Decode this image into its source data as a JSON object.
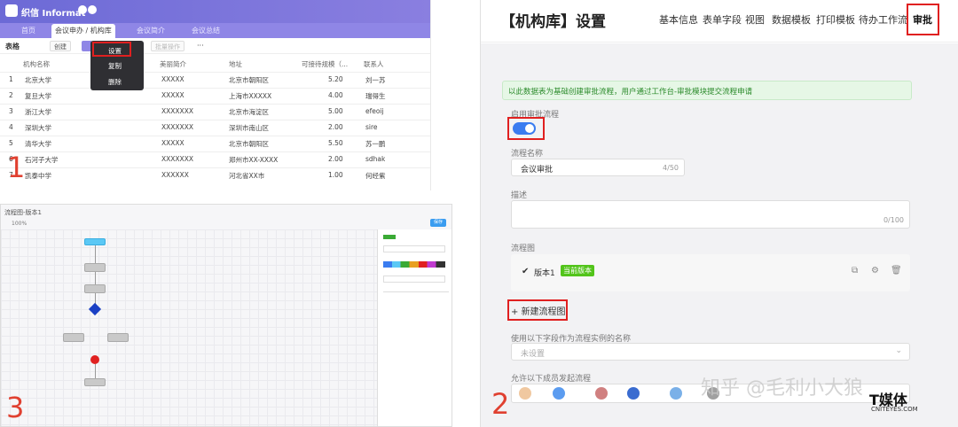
{
  "panel1": {
    "app_title": "织信 Informat",
    "tabs": [
      "首页",
      "会议申办 / 机构库",
      "会议简介",
      "会议总结"
    ],
    "toolbar": {
      "table_label": "表格",
      "create": "创建",
      "batch": "批量操作",
      "more": "···"
    },
    "menu": [
      "设置",
      "复制",
      "删除"
    ],
    "columns": [
      "机构名称",
      "美丽简介",
      "地址",
      "可接待规模（...",
      "联系人"
    ],
    "rows": [
      [
        "1",
        "北京大学",
        "XXXXX",
        "北京市朝阳区",
        "5.20",
        "刘一苏"
      ],
      [
        "2",
        "复旦大学",
        "XXXXX",
        "上海市XXXXX",
        "4.00",
        "瑞得生"
      ],
      [
        "3",
        "浙江大学",
        "XXXXXXX",
        "北京市海淀区",
        "5.00",
        "efeoij"
      ],
      [
        "4",
        "深圳大学",
        "XXXXXXX",
        "深圳市南山区",
        "2.00",
        "sire"
      ],
      [
        "5",
        "清华大学",
        "XXXXX",
        "北京市朝阳区",
        "5.50",
        "苏一鹏"
      ],
      [
        "6",
        "石河子大学",
        "XXXXXXX",
        "郑州市XX-XXXX",
        "2.00",
        "sdhak"
      ],
      [
        "7",
        "凯泰中学",
        "XXXXXX",
        "河北省XX市",
        "1.00",
        "何经紫"
      ]
    ],
    "panel_number": "1"
  },
  "panel2": {
    "title": "【机构库】设置",
    "nav": [
      "基本信息",
      "表单字段",
      "视图",
      "数据模板",
      "打印模板",
      "待办工作流",
      "审批"
    ],
    "notice": "以此数据表为基础创建审批流程，用户通过工作台-审批模块提交流程申请",
    "enable_label": "启用审批流程",
    "flow_name_label": "流程名称",
    "flow_name_value": "会议审批",
    "flow_name_count": "4/50",
    "desc_label": "描述",
    "desc_count": "0/100",
    "diagram_label": "流程图",
    "version": "版本1",
    "version_badge": "当前版本",
    "new_diagram": "新建流程图",
    "instance_name_label": "使用以下字段作为流程实例的名称",
    "instance_name_placeholder": "未设置",
    "initiators_label": "允许以下成员发起流程",
    "panel_number": "2",
    "colors": {
      "accent": "#3a7cf0",
      "badge": "#52c41a",
      "notice_bg": "#e6f7e6",
      "highlight": "#e02020"
    }
  },
  "panel3": {
    "title": "流程图-版本1",
    "zoom": "100%",
    "save": "保存",
    "panel_number": "3"
  },
  "watermark": {
    "text": "知乎 @毛利小大狼",
    "brand": "T媒体",
    "brand_url": "CNITEYES.COM"
  }
}
